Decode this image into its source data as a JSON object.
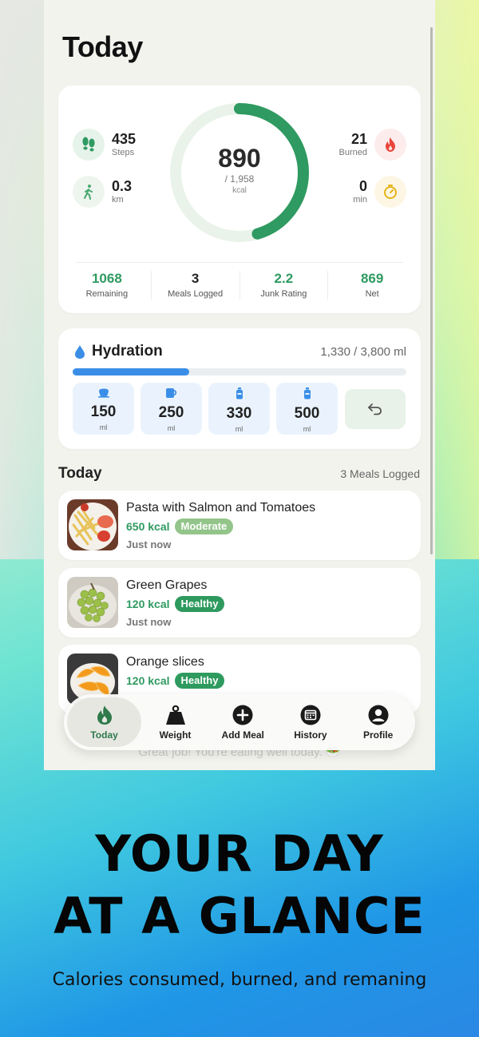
{
  "page": {
    "title": "Today"
  },
  "activity": {
    "steps": {
      "value": "435",
      "label": "Steps"
    },
    "distance": {
      "value": "0.3",
      "label": "km"
    },
    "burned": {
      "value": "21",
      "label": "Burned"
    },
    "minutes": {
      "value": "0",
      "label": "min"
    }
  },
  "calories": {
    "consumed": "890",
    "goal": "/ 1,958",
    "unit": "kcal",
    "progress": 0.4545
  },
  "metrics": [
    {
      "value": "1068",
      "label": "Remaining"
    },
    {
      "value": "3",
      "label": "Meals Logged"
    },
    {
      "value": "2.2",
      "label": "Junk Rating"
    },
    {
      "value": "869",
      "label": "Net"
    }
  ],
  "hydration": {
    "title": "Hydration",
    "amount": "1,330 / 3,800 ml",
    "progress": 0.35,
    "buttons": [
      {
        "value": "150",
        "unit": "ml",
        "icon": "cup-icon"
      },
      {
        "value": "250",
        "unit": "ml",
        "icon": "mug-icon"
      },
      {
        "value": "330",
        "unit": "ml",
        "icon": "bottle-icon"
      },
      {
        "value": "500",
        "unit": "ml",
        "icon": "bottle-icon"
      }
    ],
    "undo_icon": "undo-icon"
  },
  "meals": {
    "title": "Today",
    "count": "3 Meals Logged",
    "items": [
      {
        "name": "Pasta with Salmon and Tomatoes",
        "kcal": "650 kcal",
        "rating": "Moderate",
        "time": "Just now"
      },
      {
        "name": "Green Grapes",
        "kcal": "120 kcal",
        "rating": "Healthy",
        "time": "Just now"
      },
      {
        "name": "Orange slices",
        "kcal": "120 kcal",
        "rating": "Healthy",
        "time": ""
      }
    ]
  },
  "footer_message": "Great job! You're eating well today. 🥗",
  "tabs": [
    {
      "label": "Today",
      "icon": "flame-icon",
      "active": true
    },
    {
      "label": "Weight",
      "icon": "weight-icon"
    },
    {
      "label": "Add Meal",
      "icon": "plus-circle-icon"
    },
    {
      "label": "History",
      "icon": "calendar-icon"
    },
    {
      "label": "Profile",
      "icon": "person-icon"
    }
  ],
  "promo": {
    "headline_line1": "YOUR DAY",
    "headline_line2": "AT A GLANCE",
    "subtitle": "Calories consumed, burned, and remaning"
  },
  "colors": {
    "accent_green": "#2f9a61",
    "water_blue": "#3a8ee6",
    "moderate": "#93c58a",
    "healthy": "#2e9a5e"
  }
}
